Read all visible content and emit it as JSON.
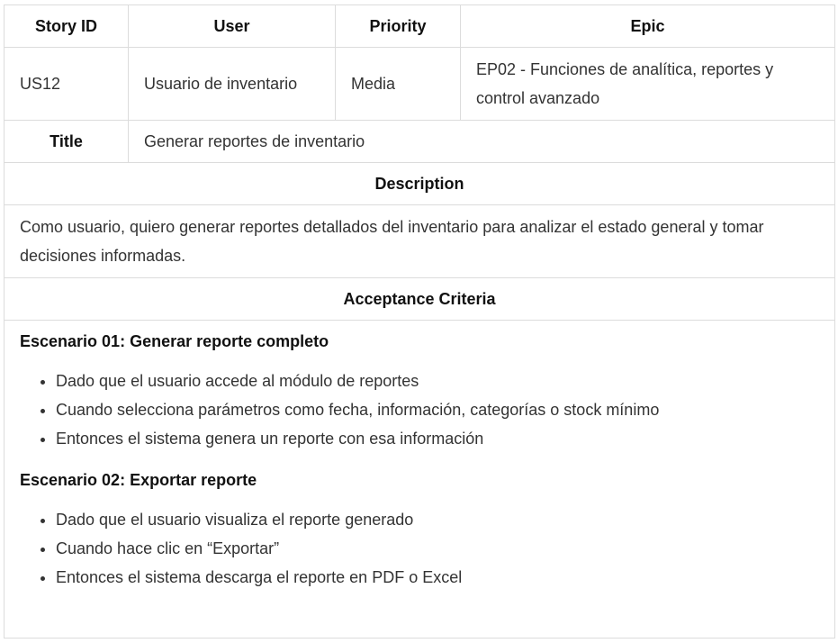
{
  "header": {
    "story_id": "Story ID",
    "user": "User",
    "priority": "Priority",
    "epic": "Epic"
  },
  "story": {
    "id": "US12",
    "user": "Usuario de inventario",
    "priority": "Media",
    "epic": "EP02 - Funciones de analítica, reportes y control avanzado"
  },
  "title_label": "Title",
  "title_value": "Generar reportes de inventario",
  "description_label": "Description",
  "description_text": "Como usuario, quiero generar reportes detallados del inventario para analizar el estado general y tomar decisiones informadas.",
  "acceptance_label": "Acceptance Criteria",
  "scenarios": [
    {
      "title": "Escenario 01: Generar reporte completo",
      "steps": [
        "Dado que el usuario accede al módulo de reportes",
        "Cuando selecciona parámetros como fecha, información, categorías o stock mínimo",
        "Entonces el sistema genera un reporte con esa información"
      ]
    },
    {
      "title": "Escenario 02: Exportar reporte",
      "steps": [
        "Dado que el usuario visualiza el reporte generado",
        "Cuando hace clic en “Exportar”",
        "Entonces el sistema descarga el reporte en PDF o Excel"
      ]
    }
  ]
}
